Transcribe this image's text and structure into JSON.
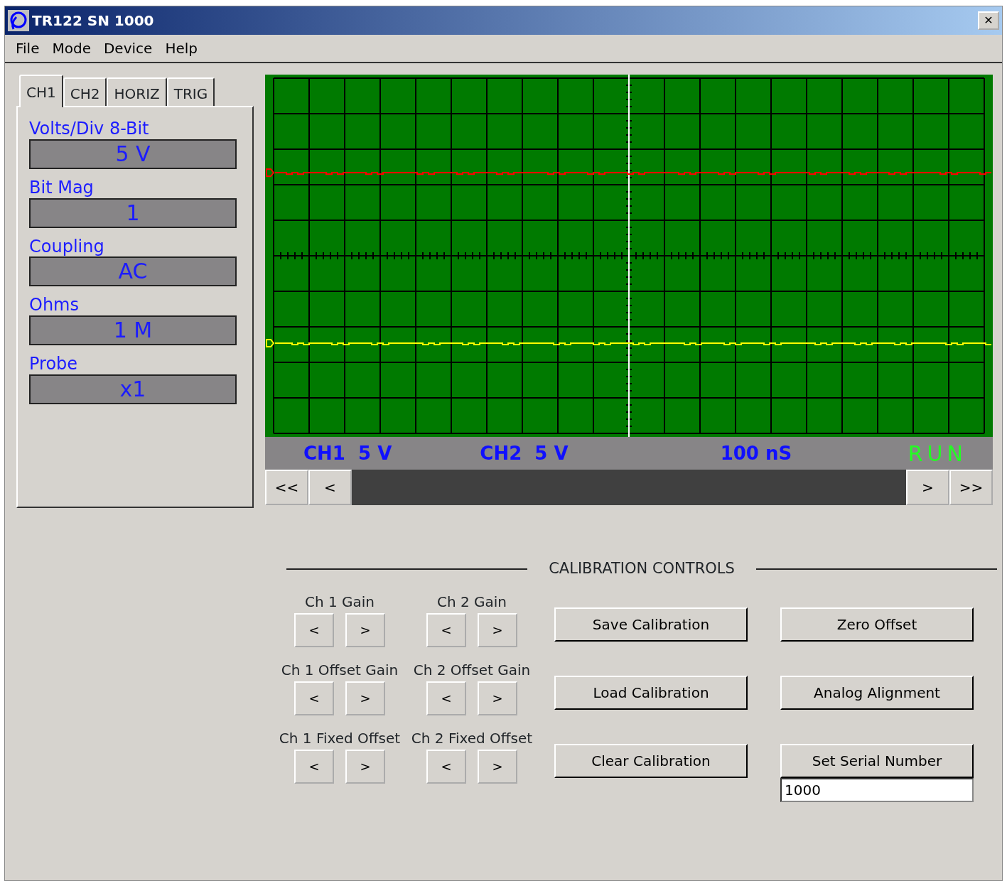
{
  "window": {
    "title": "TR122 SN 1000",
    "close": "✕"
  },
  "menu": [
    "File",
    "Mode",
    "Device",
    "Help"
  ],
  "tabs": [
    {
      "label": "CH1",
      "selected": true
    },
    {
      "label": "CH2",
      "selected": false
    },
    {
      "label": "HORIZ",
      "selected": false
    },
    {
      "label": "TRIG",
      "selected": false
    }
  ],
  "settings": [
    {
      "label": "Volts/Div 8-Bit",
      "value": "5 V"
    },
    {
      "label": "Bit Mag",
      "value": "1"
    },
    {
      "label": "Coupling",
      "value": "AC"
    },
    {
      "label": "Ohms",
      "value": "1 M"
    },
    {
      "label": "Probe",
      "value": "x1"
    }
  ],
  "scope": {
    "traces": [
      {
        "color": "#ff0000"
      },
      {
        "color": "#ffff00"
      }
    ],
    "status": [
      "CH1  5 V",
      "CH2  5 V",
      "100 nS"
    ],
    "run_state": "RUN",
    "scroll_buttons": [
      "<<",
      "<",
      ">",
      ">>"
    ]
  },
  "calibration": {
    "title": "CALIBRATION CONTROLS",
    "adjusters": [
      {
        "label": "Ch 1 Gain",
        "buttons": [
          "<",
          ">"
        ]
      },
      {
        "label": "Ch 2 Gain",
        "buttons": [
          "<",
          ">"
        ]
      },
      {
        "label": "Ch 1 Offset Gain",
        "buttons": [
          "<",
          ">"
        ]
      },
      {
        "label": "Ch 2 Offset Gain",
        "buttons": [
          "<",
          ">"
        ]
      },
      {
        "label": "Ch 1 Fixed Offset",
        "buttons": [
          "<",
          ">"
        ]
      },
      {
        "label": "Ch 2 Fixed Offset",
        "buttons": [
          "<",
          ">"
        ]
      }
    ],
    "actions": [
      {
        "label": "Save Calibration"
      },
      {
        "label": "Zero Offset"
      },
      {
        "label": "Load Calibration"
      },
      {
        "label": "Analog Alignment"
      },
      {
        "label": "Clear Calibration"
      },
      {
        "label": "Set Serial Number"
      }
    ],
    "serial_number": "1000"
  }
}
